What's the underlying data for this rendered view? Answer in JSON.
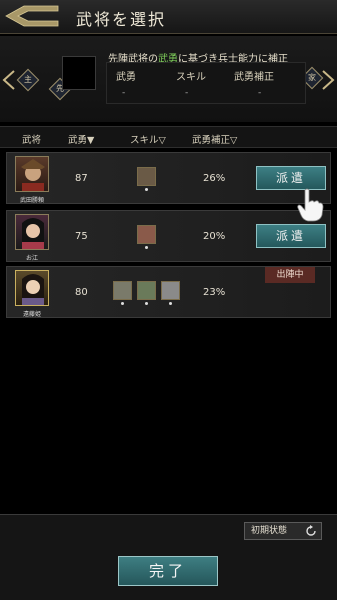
{
  "header": {
    "title": "武将を選択"
  },
  "panel": {
    "left_tag": "主",
    "center_tag": "先",
    "right_tag": "家",
    "notice_prefix": "先陣武将の",
    "notice_highlight": "武勇",
    "notice_suffix": "に基づき兵士能力に補正",
    "stat_headers": [
      "武勇",
      "スキル",
      "武勇補正"
    ],
    "stat_values": [
      "-",
      "-",
      "-"
    ]
  },
  "table": {
    "headers": [
      "武将",
      "武勇▼",
      "スキル▽",
      "武勇補正▽"
    ],
    "rows": [
      {
        "name": "武田勝頼",
        "valor": "87",
        "bonus": "26%",
        "action": "派遣",
        "status": ""
      },
      {
        "name": "お江",
        "valor": "75",
        "bonus": "20%",
        "action": "派遣",
        "status": ""
      },
      {
        "name": "遠藤姫",
        "valor": "80",
        "bonus": "23%",
        "action": "",
        "status": "出陣中"
      }
    ]
  },
  "footer": {
    "reset_label": "初期状態",
    "done_label": "完了"
  },
  "colors": {
    "accent": "#3e7e82",
    "highlight": "#7fd05a",
    "deployed": "#5a2a24"
  }
}
